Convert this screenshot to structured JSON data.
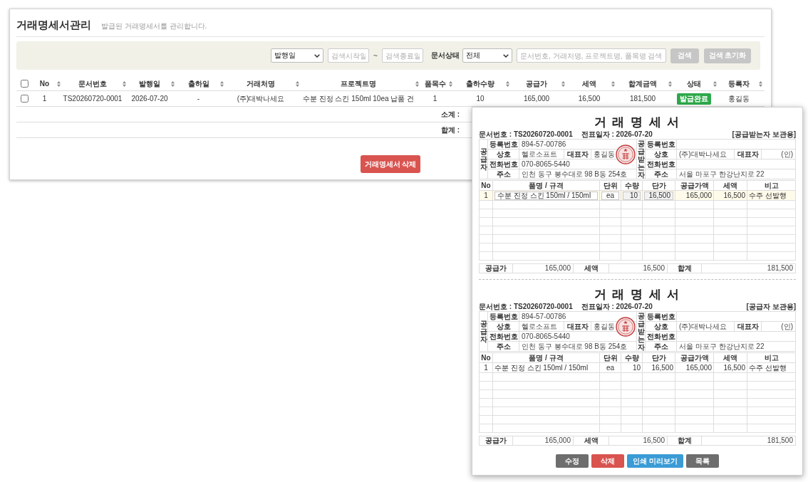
{
  "header": {
    "title": "거래명세서관리",
    "subtitle": "발급된 거래명세서를 관리합니다."
  },
  "search": {
    "date_type": "발행일",
    "start_date": {
      "placeholder": "검색시작일"
    },
    "range_separator": "~",
    "end_date": {
      "placeholder": "검색종료일"
    },
    "status_label": "문서상태",
    "status": "전체",
    "keyword": {
      "placeholder": "문서번호, 거래처명, 프로젝트명, 품목명 검색"
    },
    "buttons": [
      "검색",
      "검색 초기화"
    ]
  },
  "table": {
    "select_all": {
      "checked": false
    },
    "columns": [
      "No",
      "문서번호",
      "발행일",
      "출하일",
      "거래처명",
      "프로젝트명",
      "품목수",
      "출하수량",
      "공급가",
      "세액",
      "합계금액",
      "상태",
      "등록자"
    ],
    "rows": [
      {
        "checked": false,
        "no": "1",
        "doc_no": "TS20260720-0001",
        "issue_date": "2026-07-20",
        "ship_date": "-",
        "client": "(주)대박나세요",
        "project": "수분 진정 스킨 150ml 10ea 납품 건",
        "item_count": "1",
        "ship_qty": "10",
        "supply": "165,000",
        "tax": "16,500",
        "total": "181,500",
        "status": {
          "label": "발급완료",
          "color": "#2ea84a"
        },
        "registrant": "홍길동"
      }
    ],
    "summary_rows": [
      "소계 :",
      "합계 :"
    ]
  },
  "delete_button": "거래명세서 삭제",
  "document": {
    "copies": [
      {
        "title": "거 래 명 세 서",
        "doc_no": "문서번호 : TS20260720-0001",
        "slip_date": "전표일자 : 2026-07-20",
        "copy_label": "[공급받는자 보관용]",
        "supplier": {
          "heading": "공급자",
          "reg_no_label": "등록번호",
          "reg_no": "894-57-00786",
          "name_label": "상호",
          "name": "헬로소프트",
          "ceo_label": "대표자",
          "ceo": "홍길동",
          "phone_label": "전화번호",
          "phone": "070-8065-5440",
          "address_label": "주소",
          "address": "인천 동구 봉수대로 98 B동 254호",
          "seal": true
        },
        "receiver": {
          "heading": "공급받는자",
          "reg_no_label": "등록번호",
          "name_label": "상호",
          "name": "(주)대박나세요",
          "ceo_label": "대표자",
          "ceo": "(인)",
          "phone_label": "전화번호",
          "address_label": "주소",
          "address": "서울 마포구 한강난지로 22"
        },
        "item_columns": [
          "No",
          "품명 / 규격",
          "단위",
          "수량",
          "단가",
          "공급가액",
          "세액",
          "비고"
        ],
        "editable": true,
        "items": [
          {
            "no": "1",
            "name": "수분 진정 스킨 150ml / 150ml",
            "unit": "ea",
            "qty": "10",
            "price": "16,500",
            "supply": "165,000",
            "tax": "16,500",
            "note": "수주 선발행"
          }
        ],
        "totals": {
          "supply_label": "공급가",
          "supply": "165,000",
          "tax_label": "세액",
          "tax": "16,500",
          "total_label": "합계",
          "total": "181,500"
        }
      },
      {
        "title": "거 래 명 세 서",
        "doc_no": "문서번호 : TS20260720-0001",
        "slip_date": "전표일자 : 2026-07-20",
        "copy_label": "[공급자 보관용]",
        "supplier": {
          "heading": "공급자",
          "reg_no_label": "등록번호",
          "reg_no": "894-57-00786",
          "name_label": "상호",
          "name": "헬로소프트",
          "ceo_label": "대표자",
          "ceo": "홍길동",
          "phone_label": "전화번호",
          "phone": "070-8065-5440",
          "address_label": "주소",
          "address": "인천 동구 봉수대로 98 B동 254호",
          "seal": true
        },
        "receiver": {
          "heading": "공급받는자",
          "reg_no_label": "등록번호",
          "name_label": "상호",
          "name": "(주)대박나세요",
          "ceo_label": "대표자",
          "ceo": "(인)",
          "phone_label": "전화번호",
          "address_label": "주소",
          "address": "서울 마포구 한강난지로 22"
        },
        "item_columns": [
          "No",
          "품명 / 규격",
          "단위",
          "수량",
          "단가",
          "공급가액",
          "세액",
          "비고"
        ],
        "editable": false,
        "items": [
          {
            "no": "1",
            "name": "수분 진정 스킨 150ml / 150ml",
            "unit": "ea",
            "qty": "10",
            "price": "16,500",
            "supply": "165,000",
            "tax": "16,500",
            "note": "수주 선발행"
          }
        ],
        "totals": {
          "supply_label": "공급가",
          "supply": "165,000",
          "tax_label": "세액",
          "tax": "16,500",
          "total_label": "합계",
          "total": "181,500"
        }
      }
    ],
    "buttons": [
      {
        "label": "수정",
        "kind": "secondary"
      },
      {
        "label": "삭제",
        "kind": "danger"
      },
      {
        "label": "인쇄 미리보기",
        "kind": "info"
      },
      {
        "label": "목록",
        "kind": "secondary"
      }
    ]
  }
}
